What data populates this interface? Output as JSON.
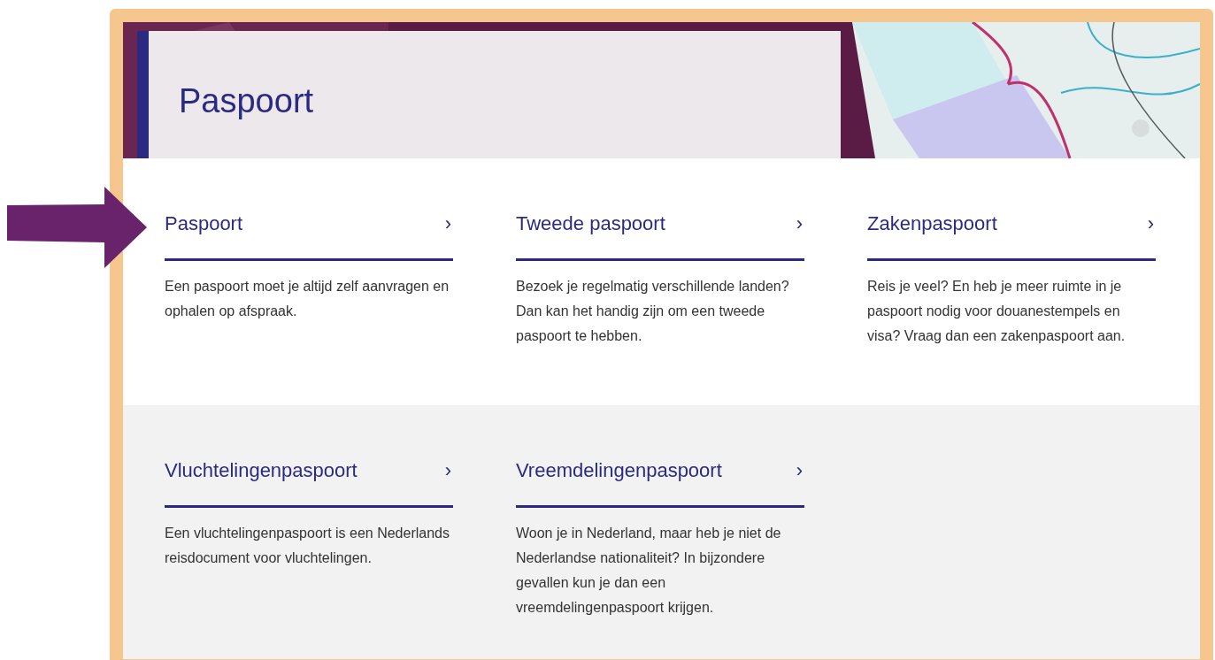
{
  "header": {
    "title": "Paspoort"
  },
  "sections": [
    {
      "cards": [
        {
          "title": "Paspoort",
          "chevron": "›",
          "text": "Een paspoort moet je altijd zelf aanvragen en ophalen op afspraak."
        },
        {
          "title": "Tweede paspoort",
          "chevron": "›",
          "text": "Bezoek je regelmatig verschillende landen? Dan kan het handig zijn om een tweede paspoort te hebben."
        },
        {
          "title": "Zakenpaspoort",
          "chevron": "›",
          "text": "Reis je veel? En heb je meer ruimte in je paspoort nodig voor douanestempels en visa? Vraag dan een zakenpaspoort aan."
        }
      ]
    },
    {
      "cards": [
        {
          "title": "Vluchtelingenpaspoort",
          "chevron": "›",
          "text": "Een vluchtelingenpaspoort is een Nederlands reisdocument voor vluchtelingen."
        },
        {
          "title": "Vreemdelingenpaspoort",
          "chevron": "›",
          "text": "Woon je in Nederland, maar heb je niet de Nederlandse nationaliteit? In bijzondere gevallen kun je dan een vreemdelingenpaspoort krijgen."
        }
      ]
    }
  ]
}
